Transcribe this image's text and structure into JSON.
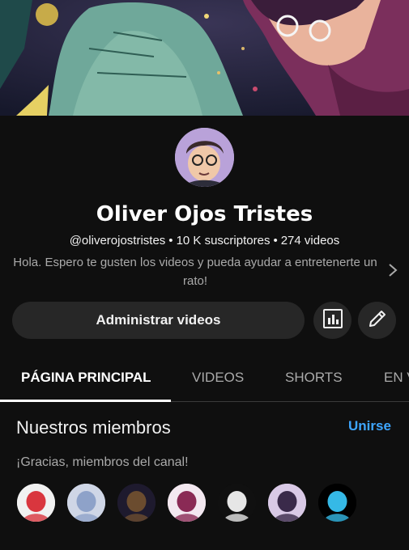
{
  "banner": {
    "description": "channel-banner-art"
  },
  "channel": {
    "name": "Oliver Ojos Tristes",
    "handle": "@oliverojostristes",
    "separator": "•",
    "subscribers": "10 K suscriptores",
    "videos": "274 videos",
    "description": "Hola. Espero te gusten los videos y pueda ayudar a entretenerte un rato!"
  },
  "actions": {
    "manage_label": "Administrar videos",
    "analytics_icon": "analytics-icon",
    "edit_icon": "pencil-icon"
  },
  "tabs": [
    {
      "label": "PÁGINA PRINCIPAL",
      "active": true
    },
    {
      "label": "VIDEOS",
      "active": false
    },
    {
      "label": "SHORTS",
      "active": false
    },
    {
      "label": "EN V",
      "active": false
    }
  ],
  "members": {
    "title": "Nuestros miembros",
    "join_label": "Unirse",
    "thanks": "¡Gracias, miembros del canal!",
    "avatars": [
      {
        "bg": "#f1f1f1",
        "accent": "#d9363e"
      },
      {
        "bg": "#cfd6e6",
        "accent": "#8ea2c9"
      },
      {
        "bg": "#1e1a2e",
        "accent": "#6b4c2f"
      },
      {
        "bg": "#f3e8f0",
        "accent": "#8a2a55"
      },
      {
        "bg": "#101010",
        "accent": "#e6e6e6"
      },
      {
        "bg": "#d9c9e6",
        "accent": "#3a2a4a"
      },
      {
        "bg": "#000000",
        "accent": "#35b9e6"
      }
    ]
  },
  "colors": {
    "background": "#0f0f0f",
    "button_bg": "#272727",
    "link_blue": "#3ea6ff",
    "secondary_text": "#aaaaaa"
  }
}
